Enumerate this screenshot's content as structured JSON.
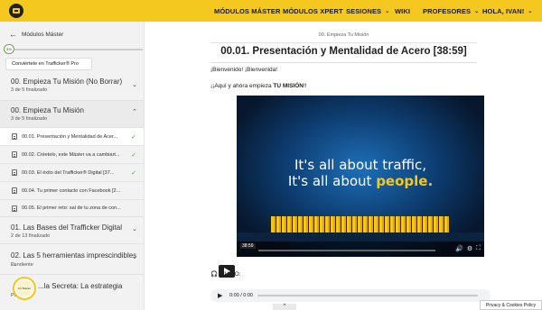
{
  "header": {
    "logo_icon": "trafficker-logo-icon",
    "nav": [
      {
        "label": "MÓDULOS MÁSTER",
        "chevron": false
      },
      {
        "label": "MÓDULOS XPERT",
        "chevron": false
      },
      {
        "label": "SESIONES",
        "chevron": true
      },
      {
        "label": "WIKI",
        "chevron": false
      },
      {
        "label": "PROFESORES",
        "chevron": true
      },
      {
        "label": "HOLA, IVAN!",
        "chevron": true
      }
    ],
    "color": "#f4c81f"
  },
  "sidebar": {
    "back_label": "Módulos Máster",
    "progress_badge": "3%",
    "progress_value": 3,
    "promo_label": "Conviértete en Trafficker® Pro",
    "sections": [
      {
        "title": "00. Empieza Tu Misión (No Borrar)",
        "sub": "3 de 5 finalizado",
        "expanded": false
      },
      {
        "title": "00. Empieza Tu Misión",
        "sub": "3 de 5 finalizado",
        "expanded": true
      },
      {
        "title": "01. Las Bases del Trafficker Digital",
        "sub": "2 de 13 finalizado",
        "expanded": false
      },
      {
        "title": "02. Las 5 herramientas imprescindibles ...",
        "sub": "Pendiente",
        "expanded": false
      },
      {
        "title": "...la Secreta: La estrategia",
        "sub": "Pendiente",
        "expanded": false
      }
    ],
    "lessons": [
      {
        "label": "00.01. Presentación y Mentalidad de Acer...",
        "done": true
      },
      {
        "label": "00.02. Créetelo, este Máster va a cambiart...",
        "done": true
      },
      {
        "label": "00.03. El éxito del Trafficker® Digital [37...",
        "done": true
      },
      {
        "label": "00.04. Tu primer contacto con Facebook [2...",
        "done": false
      },
      {
        "label": "00.05. El primer reto: sal de tu zona de con...",
        "done": false
      }
    ],
    "badge_text": "CV Máster"
  },
  "main": {
    "breadcrumb": "00. Empieza Tu Misión",
    "title": "00.01. Presentación y Mentalidad de Acero [38:59]",
    "p1": "¡Bienvenido! ¡Bienvenida!",
    "p2_prefix": "¡¡Aquí y ahora empieza ",
    "p2_bold": "TU MISIÓN",
    "p2_suffix": "!!",
    "video": {
      "line1": "It's all about traffic,",
      "line2_prefix": "It's all about ",
      "line2_highlight": "people.",
      "timestamp": "38:59",
      "progress": 0
    },
    "audio_label": "AUDIO:",
    "audio_time": "0:00 / 0:00"
  },
  "footer": {
    "privacy_label": "Privacy & Cookies Policy",
    "up_label": "^"
  }
}
